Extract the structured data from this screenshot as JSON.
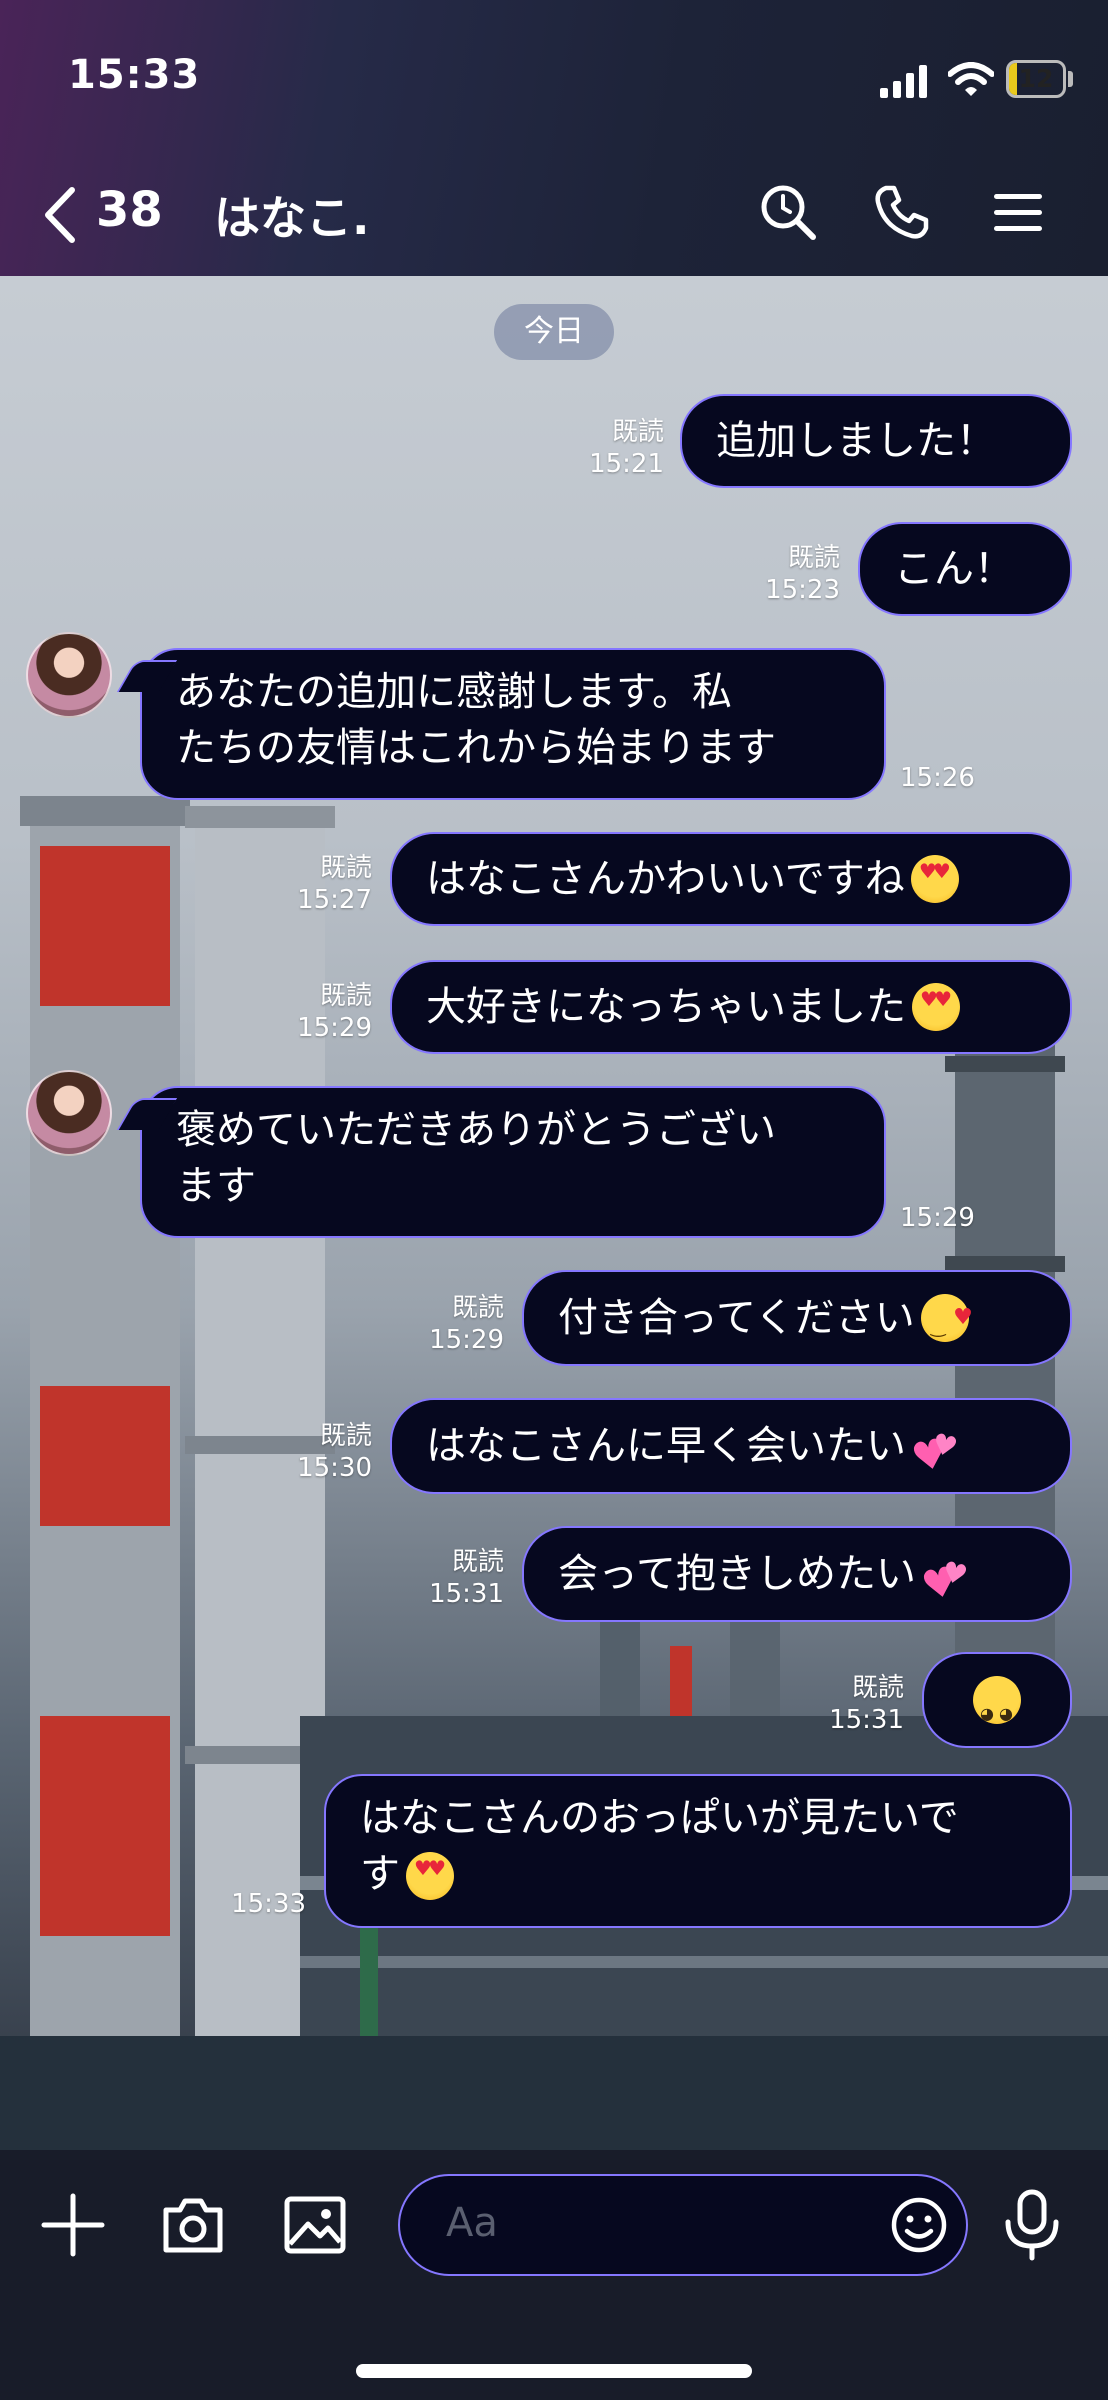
{
  "status_bar": {
    "time": "15:33",
    "battery": "12"
  },
  "header": {
    "unread_count": "38",
    "chat_title": "はなこ."
  },
  "chat": {
    "date_label": "今日",
    "messages": [
      {
        "dir": "out",
        "read": "既読",
        "time": "15:21",
        "text": "追加しました！"
      },
      {
        "dir": "out",
        "read": "既読",
        "time": "15:23",
        "text": "こん！"
      },
      {
        "dir": "in",
        "time": "15:26",
        "line1": "あなたの追加に感謝します。私",
        "line2": "たちの友情はこれから始まります"
      },
      {
        "dir": "out",
        "read": "既読",
        "time": "15:27",
        "text": "はなこさんかわいいですね",
        "emoji": "heart-eyes-emoji"
      },
      {
        "dir": "out",
        "read": "既読",
        "time": "15:29",
        "text": "大好きになっちゃいました",
        "emoji": "heart-eyes-emoji"
      },
      {
        "dir": "in",
        "time": "15:29",
        "line1": "褒めていただきありがとうござい",
        "line2": "ます"
      },
      {
        "dir": "out",
        "read": "既読",
        "time": "15:29",
        "text": "付き合ってください",
        "emoji": "kissing-heart-emoji"
      },
      {
        "dir": "out",
        "read": "既読",
        "time": "15:30",
        "text": "はなこさんに早く会いたい",
        "emoji": "two-hearts-emoji"
      },
      {
        "dir": "out",
        "read": "既読",
        "time": "15:31",
        "text": "会って抱きしめたい",
        "emoji": "two-hearts-emoji"
      },
      {
        "dir": "out",
        "read": "既読",
        "time": "15:31",
        "text": "",
        "emoji": "pleading-face-emoji"
      },
      {
        "dir": "out",
        "time": "15:33",
        "line1": "はなこさんのおっぱいが見たいで",
        "line2": "す",
        "emoji": "heart-eyes-emoji"
      }
    ]
  },
  "input": {
    "placeholder": "Aa"
  },
  "colors": {
    "bubble_bg": "#06081f",
    "bubble_border": "#8577ff"
  }
}
